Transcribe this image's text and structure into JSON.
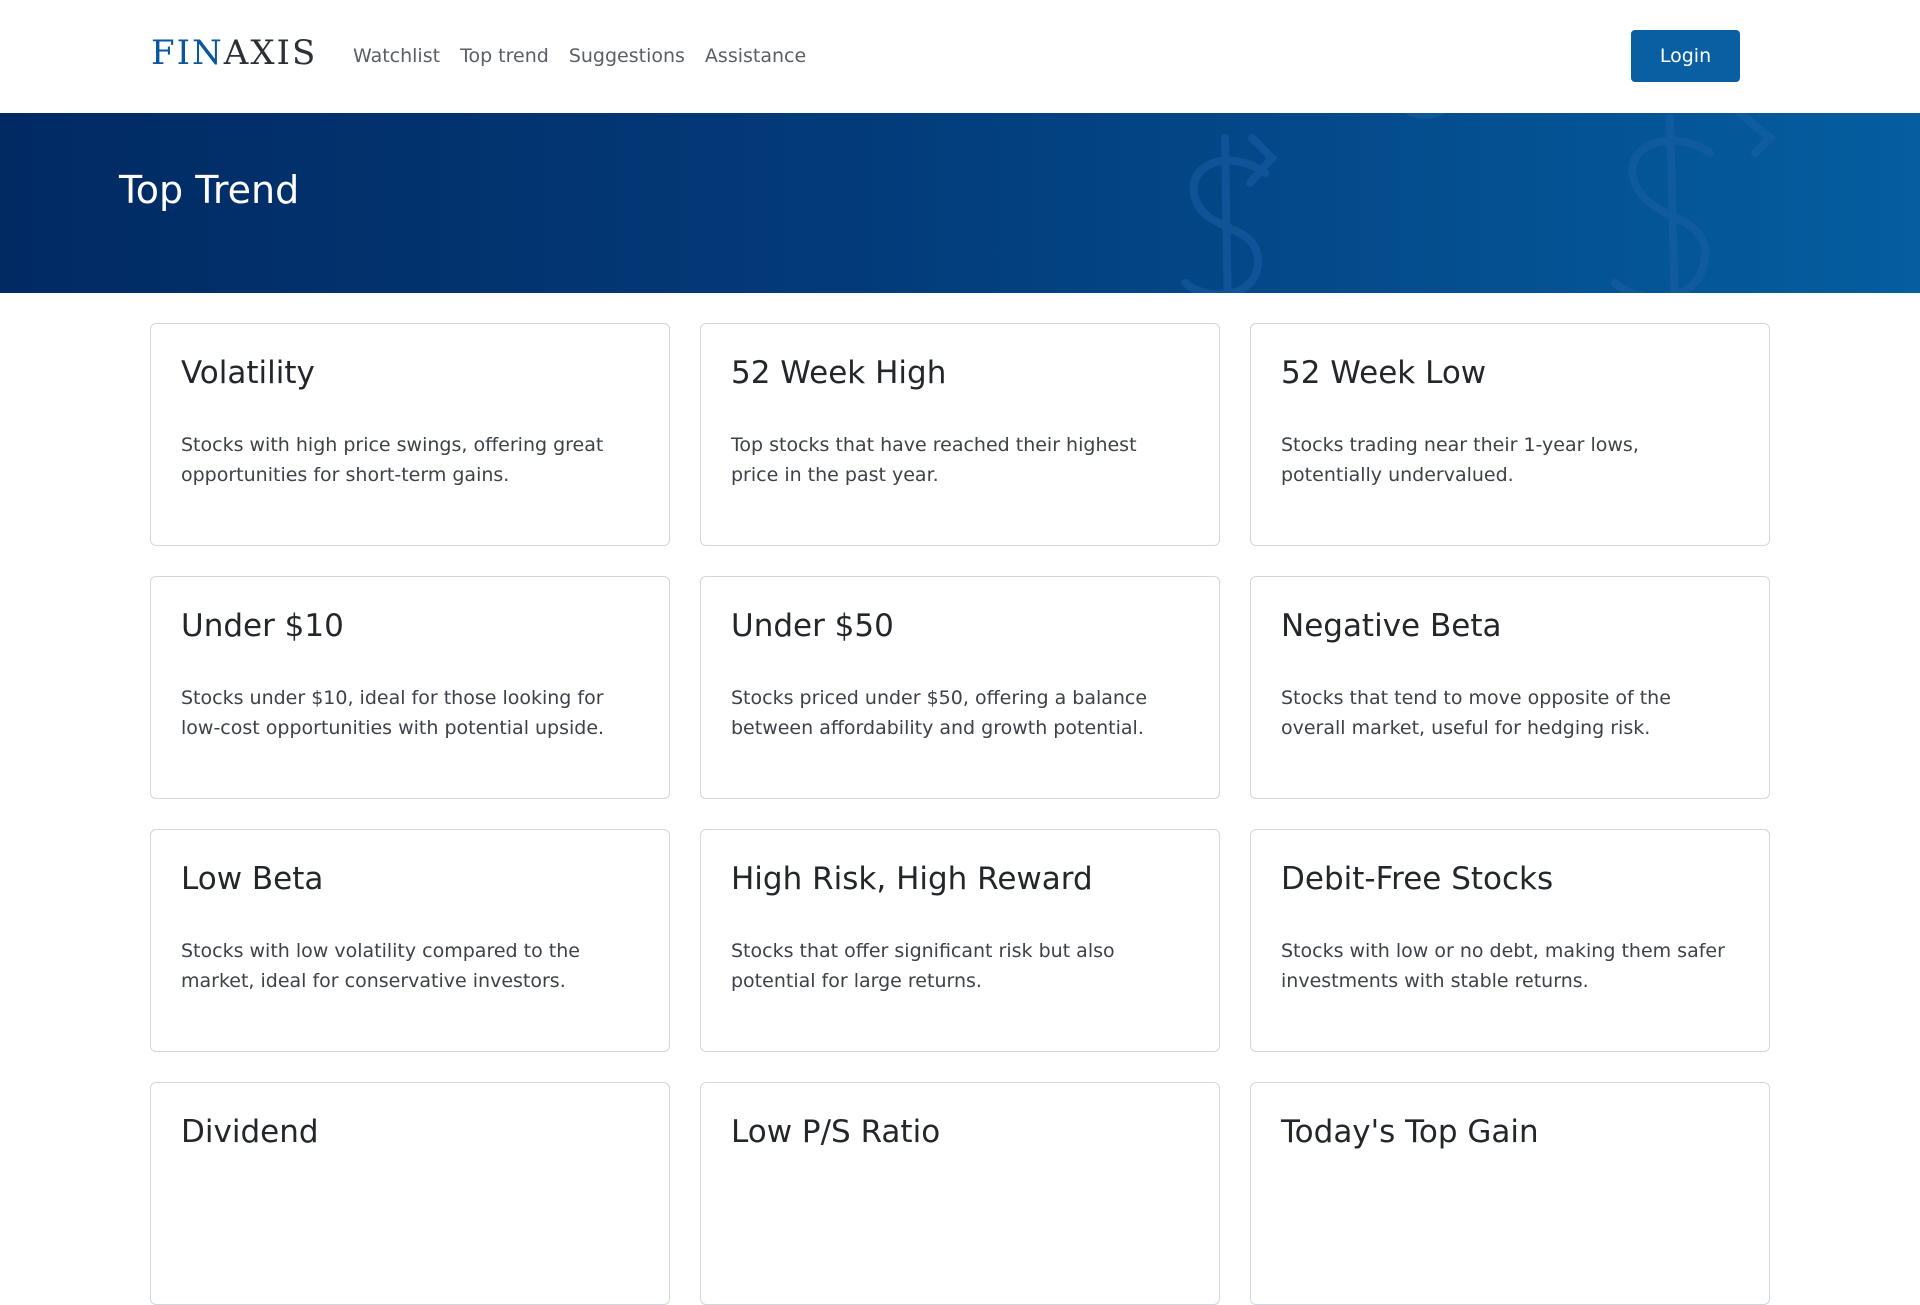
{
  "brand": {
    "logo_part_a": "FIN",
    "logo_part_b": "AXIS",
    "primary_color": "#0a5fa3",
    "hero_gradient": [
      "#012a63",
      "#045ea0"
    ]
  },
  "nav": {
    "links": [
      {
        "label": "Watchlist"
      },
      {
        "label": "Top trend"
      },
      {
        "label": "Suggestions"
      },
      {
        "label": "Assistance"
      }
    ],
    "login_label": "Login"
  },
  "hero": {
    "title": "Top Trend",
    "decoration_icon": "dollar-sign-icon"
  },
  "cards": [
    {
      "title": "Volatility",
      "description": "Stocks with high price swings, offering great opportunities for short-term gains."
    },
    {
      "title": "52 Week High",
      "description": "Top stocks that have reached their highest price in the past year."
    },
    {
      "title": "52 Week Low",
      "description": "Stocks trading near their 1-year lows, potentially undervalued."
    },
    {
      "title": "Under $10",
      "description": "Stocks under $10, ideal for those looking for low-cost opportunities with potential upside."
    },
    {
      "title": "Under $50",
      "description": "Stocks priced under $50, offering a balance between affordability and growth potential."
    },
    {
      "title": "Negative Beta",
      "description": "Stocks that tend to move opposite of the overall market, useful for hedging risk."
    },
    {
      "title": "Low Beta",
      "description": "Stocks with low volatility compared to the market, ideal for conservative investors."
    },
    {
      "title": "High Risk, High Reward",
      "description": "Stocks that offer significant risk but also potential for large returns."
    },
    {
      "title": "Debit-Free Stocks",
      "description": "Stocks with low or no debt, making them safer investments with stable returns."
    },
    {
      "title": "Dividend",
      "description": ""
    },
    {
      "title": "Low P/S Ratio",
      "description": ""
    },
    {
      "title": "Today's Top Gain",
      "description": ""
    }
  ]
}
